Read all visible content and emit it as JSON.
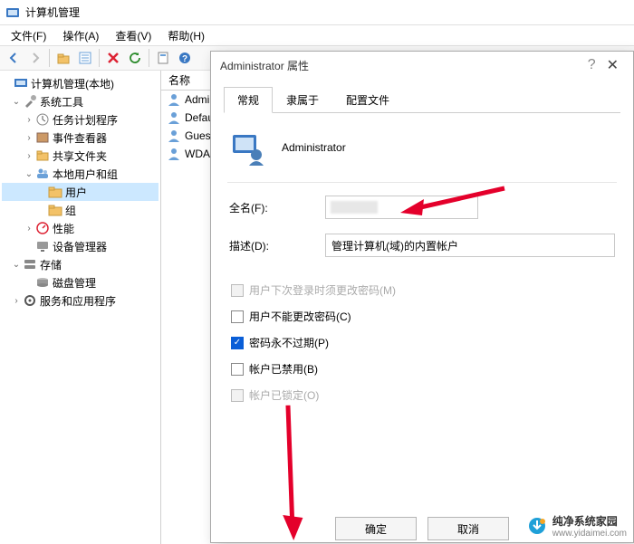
{
  "window": {
    "title": "计算机管理"
  },
  "menubar": {
    "file": "文件(F)",
    "action": "操作(A)",
    "view": "查看(V)",
    "help": "帮助(H)"
  },
  "tree": {
    "root": "计算机管理(本地)",
    "system_tools": "系统工具",
    "task_scheduler": "任务计划程序",
    "event_viewer": "事件查看器",
    "shared_folders": "共享文件夹",
    "local_users": "本地用户和组",
    "users": "用户",
    "groups": "组",
    "performance": "性能",
    "device_manager": "设备管理器",
    "storage": "存储",
    "disk_management": "磁盘管理",
    "services_apps": "服务和应用程序"
  },
  "list": {
    "header_name": "名称",
    "items": [
      "Admin",
      "Defau",
      "Gues",
      "WDA"
    ]
  },
  "dialog": {
    "title": "Administrator 属性",
    "tabs": {
      "general": "常规",
      "member_of": "隶属于",
      "profile": "配置文件"
    },
    "username": "Administrator",
    "fullname_label": "全名(F):",
    "fullname_value": "",
    "desc_label": "描述(D):",
    "desc_value": "管理计算机(域)的内置帐户",
    "checks": {
      "must_change": "用户下次登录时须更改密码(M)",
      "cannot_change": "用户不能更改密码(C)",
      "never_expires": "密码永不过期(P)",
      "disabled": "帐户已禁用(B)",
      "locked": "帐户已锁定(O)"
    },
    "ok": "确定",
    "cancel": "取消"
  },
  "watermark": {
    "name": "纯净系统家园",
    "url": "www.yidaimei.com"
  }
}
